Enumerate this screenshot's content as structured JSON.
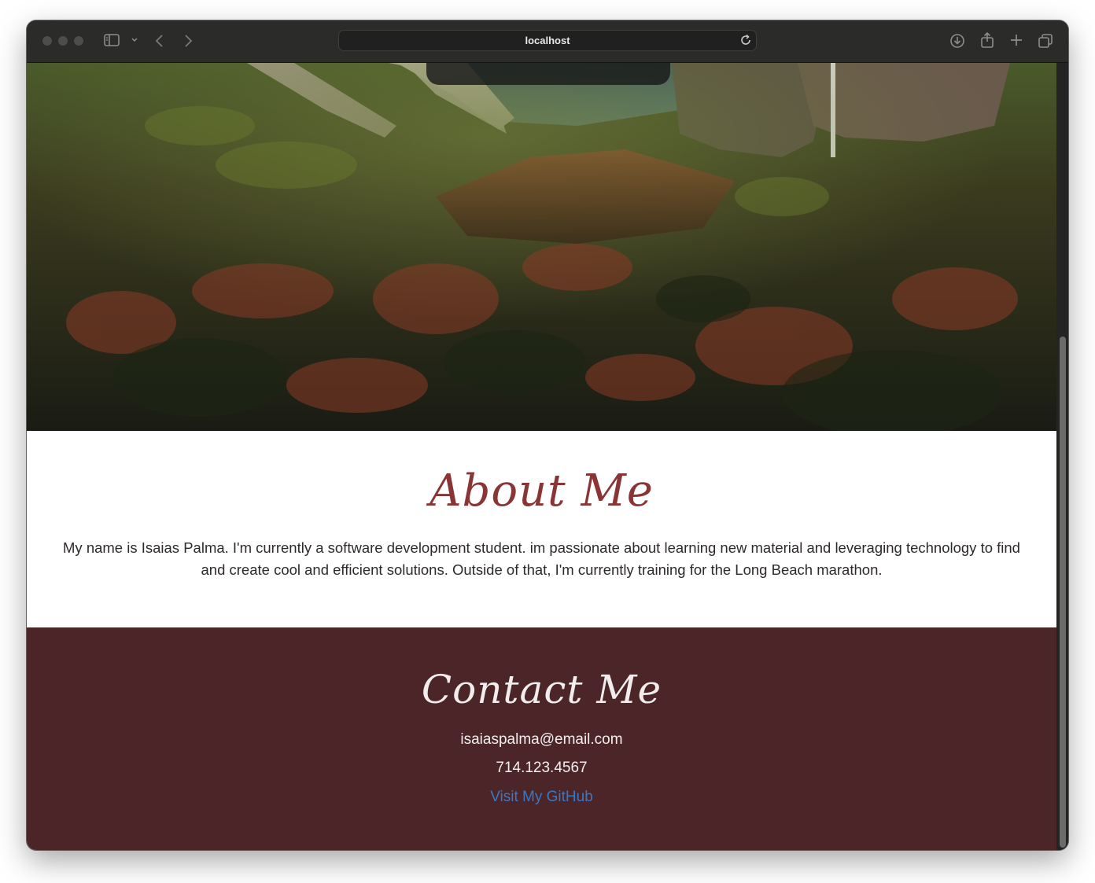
{
  "browser": {
    "url": "localhost",
    "icons": [
      "sidebar-icon",
      "chevron-down-icon",
      "back-icon",
      "forward-icon",
      "reload-icon",
      "download-icon",
      "share-icon",
      "new-tab-icon",
      "tab-overview-icon"
    ]
  },
  "about": {
    "heading": "About Me",
    "body": "My name is Isaias Palma. I'm currently a software development student. im passionate about learning new material and leveraging technology to find and create cool and efficient solutions. Outside of that, I'm currently training for the Long Beach marathon."
  },
  "contact": {
    "heading": "Contact Me",
    "email": "isaiaspalma@email.com",
    "phone": "714.123.4567",
    "github_label": "Visit My GitHub"
  },
  "colors": {
    "about_heading": "#8a3535",
    "contact_background": "#4b2527",
    "link": "#3a78c4"
  }
}
